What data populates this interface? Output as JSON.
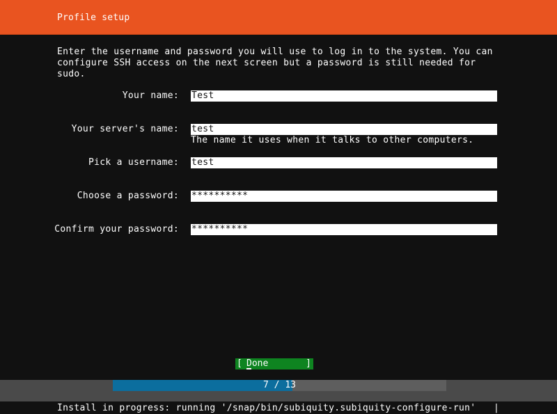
{
  "header": {
    "title": "Profile setup"
  },
  "intro": "Enter the username and password you will use to log in to the system. You can configure SSH access on the next screen but a password is still needed for sudo.",
  "fields": [
    {
      "label": "Your name:",
      "value": "Test",
      "help": ""
    },
    {
      "label": "Your server's name:",
      "value": "test",
      "help": "The name it uses when it talks to other computers."
    },
    {
      "label": "Pick a username:",
      "value": "test",
      "help": ""
    },
    {
      "label": "Choose a password:",
      "value": "**********",
      "help": ""
    },
    {
      "label": "Confirm your password:",
      "value": "**********",
      "help": ""
    }
  ],
  "done_button": {
    "left": "[",
    "label": "Done",
    "right": "]"
  },
  "progress": {
    "text": "7 / 13",
    "current": 7,
    "total": 13
  },
  "status": {
    "text": "Install in progress: running '/snap/bin/subiquity.subiquity-configure-run'",
    "cursor": "|"
  },
  "colors": {
    "accent": "#e95420",
    "done_green": "#0e8420",
    "progress_blue": "#0c6e9e"
  }
}
